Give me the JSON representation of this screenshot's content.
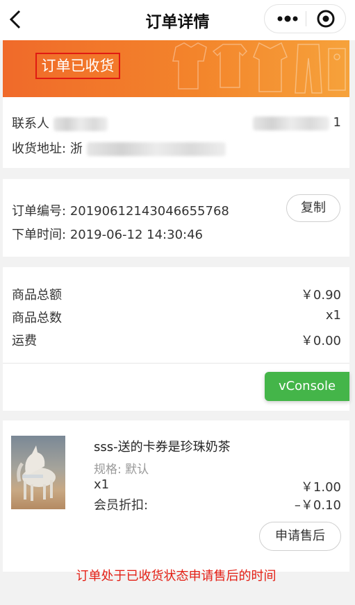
{
  "nav": {
    "title": "订单详情",
    "more_icon": "more-dots-icon",
    "target_icon": "target-icon",
    "back_icon": "back-chevron-icon"
  },
  "banner": {
    "status": "订单已收货",
    "accent": "#f06a2a",
    "highlight_color": "#e01a12"
  },
  "address": {
    "contact_label": "联系人",
    "address_label": "收货地址:",
    "address_prefix": "浙",
    "phone_tail": "1"
  },
  "order": {
    "number_label": "订单编号:",
    "number": "20190612143046655768",
    "time_label": "下单时间:",
    "time": "2019-06-12 14:30:46",
    "copy_label": "复制"
  },
  "summary": {
    "total_label": "商品总额",
    "total_value": "￥0.90",
    "count_label": "商品总数",
    "count_value": "x1",
    "shipping_label": "运费",
    "shipping_value": "￥0.00"
  },
  "vconsole": {
    "label": "vConsole",
    "color": "#44b549"
  },
  "product": {
    "name": "sss-送的卡券是珍珠奶茶",
    "spec_label": "规格:",
    "spec_value": "默认",
    "qty": "x1",
    "price": "￥1.00",
    "discount_label": "会员折扣:",
    "discount_value": "–￥0.10",
    "aftersale_label": "申请售后"
  },
  "annotation": {
    "text": "订单处于已收货状态申请售后的时间",
    "color": "#e41f15"
  }
}
